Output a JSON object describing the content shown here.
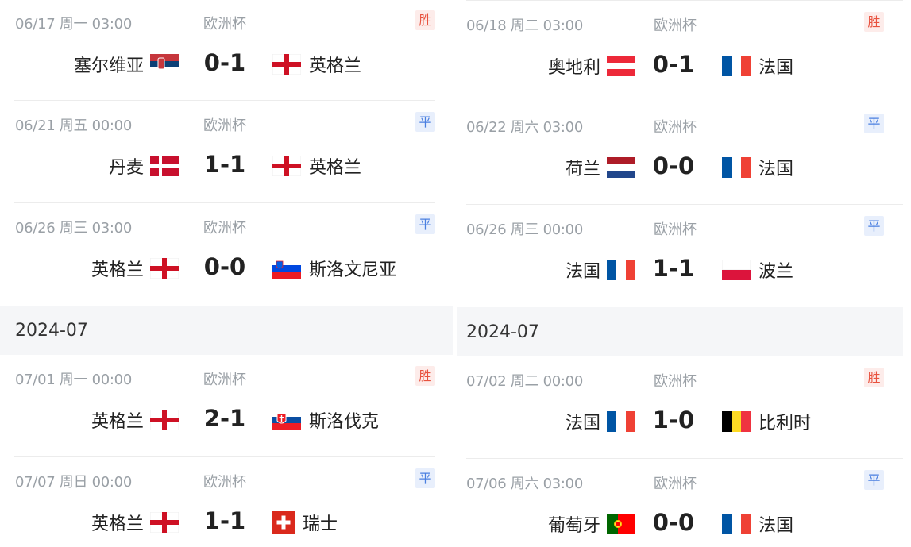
{
  "left": {
    "june": [
      {
        "date": "06/17 周一 03:00",
        "competition": "欧洲杯",
        "result": "胜",
        "home": "塞尔维亚",
        "home_flag": "serbia-flag-icon",
        "score": "0-1",
        "away": "英格兰",
        "away_flag": "england-flag-icon"
      },
      {
        "date": "06/21 周五 00:00",
        "competition": "欧洲杯",
        "result": "平",
        "home": "丹麦",
        "home_flag": "denmark-flag-icon",
        "score": "1-1",
        "away": "英格兰",
        "away_flag": "england-flag-icon"
      },
      {
        "date": "06/26 周三 03:00",
        "competition": "欧洲杯",
        "result": "平",
        "home": "英格兰",
        "home_flag": "england-flag-icon",
        "score": "0-0",
        "away": "斯洛文尼亚",
        "away_flag": "slovenia-flag-icon"
      }
    ],
    "month_label": "2024-07",
    "july": [
      {
        "date": "07/01 周一 00:00",
        "competition": "欧洲杯",
        "result": "胜",
        "home": "英格兰",
        "home_flag": "england-flag-icon",
        "score": "2-1",
        "away": "斯洛伐克",
        "away_flag": "slovakia-flag-icon"
      },
      {
        "date": "07/07 周日 00:00",
        "competition": "欧洲杯",
        "result": "平",
        "home": "英格兰",
        "home_flag": "england-flag-icon",
        "score": "1-1",
        "away": "瑞士",
        "away_flag": "switzerland-flag-icon"
      }
    ]
  },
  "right": {
    "june": [
      {
        "date": "06/18 周二 03:00",
        "competition": "欧洲杯",
        "result": "胜",
        "home": "奥地利",
        "home_flag": "austria-flag-icon",
        "score": "0-1",
        "away": "法国",
        "away_flag": "france-flag-icon"
      },
      {
        "date": "06/22 周六 03:00",
        "competition": "欧洲杯",
        "result": "平",
        "home": "荷兰",
        "home_flag": "netherlands-flag-icon",
        "score": "0-0",
        "away": "法国",
        "away_flag": "france-flag-icon"
      },
      {
        "date": "06/26 周三 00:00",
        "competition": "欧洲杯",
        "result": "平",
        "home": "法国",
        "home_flag": "france-flag-icon",
        "score": "1-1",
        "away": "波兰",
        "away_flag": "poland-flag-icon"
      }
    ],
    "month_label": "2024-07",
    "july": [
      {
        "date": "07/02 周二 00:00",
        "competition": "欧洲杯",
        "result": "胜",
        "home": "法国",
        "home_flag": "france-flag-icon",
        "score": "1-0",
        "away": "比利时",
        "away_flag": "belgium-flag-icon"
      },
      {
        "date": "07/06 周六 03:00",
        "competition": "欧洲杯",
        "result": "平",
        "home": "葡萄牙",
        "home_flag": "portugal-flag-icon",
        "score": "0-0",
        "away": "法国",
        "away_flag": "france-flag-icon"
      }
    ]
  },
  "colors": {
    "win": "#e8523e",
    "draw": "#4a7fe0",
    "meta": "#9aa0a6",
    "month_header_bg": "#f5f6f8"
  }
}
